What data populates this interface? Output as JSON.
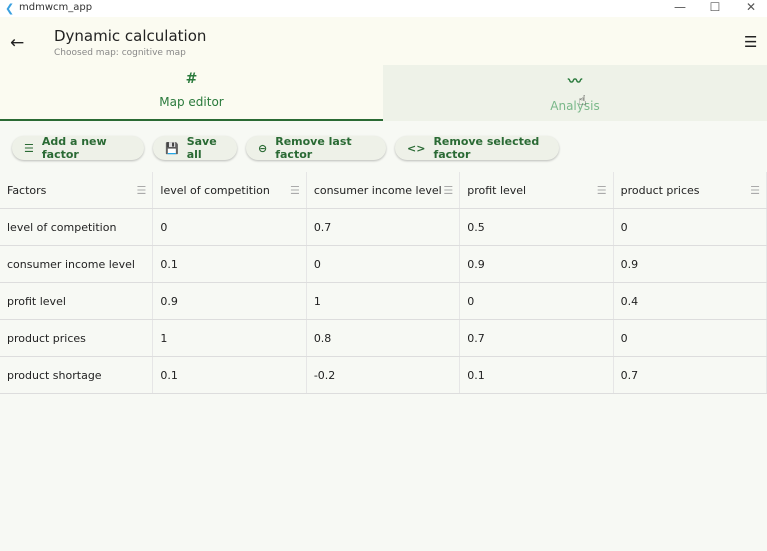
{
  "window": {
    "title": "mdmwcm_app",
    "minimize": "—",
    "maximize": "☐",
    "close": "✕"
  },
  "appbar": {
    "title": "Dynamic calculation",
    "subtitle": "Choosed map: cognitive map",
    "back_icon": "←",
    "menu_icon": "☰"
  },
  "tabs": [
    {
      "label": "Map editor",
      "icon": "#",
      "active": true
    },
    {
      "label": "Analysis",
      "icon": "〰",
      "active": false
    }
  ],
  "toolbar": [
    {
      "label": "Add a new factor",
      "icon": "☰"
    },
    {
      "label": "Save all",
      "icon": "💾"
    },
    {
      "label": "Remove last factor",
      "icon": "⊖"
    },
    {
      "label": "Remove selected factor",
      "icon": "<>"
    }
  ],
  "table": {
    "headers": [
      "Factors",
      "level of competition",
      "consumer income level",
      "profit level",
      "product prices"
    ],
    "rows": [
      [
        "level of competition",
        "0",
        "0.7",
        "0.5",
        "0"
      ],
      [
        "consumer income level",
        "0.1",
        "0",
        "0.9",
        "0.9"
      ],
      [
        "profit level",
        "0.9",
        "1",
        "0",
        "0.4"
      ],
      [
        "product prices",
        "1",
        "0.8",
        "0.7",
        "0"
      ],
      [
        "product shortage",
        "0.1",
        "-0.2",
        "0.1",
        "0.7"
      ]
    ]
  }
}
